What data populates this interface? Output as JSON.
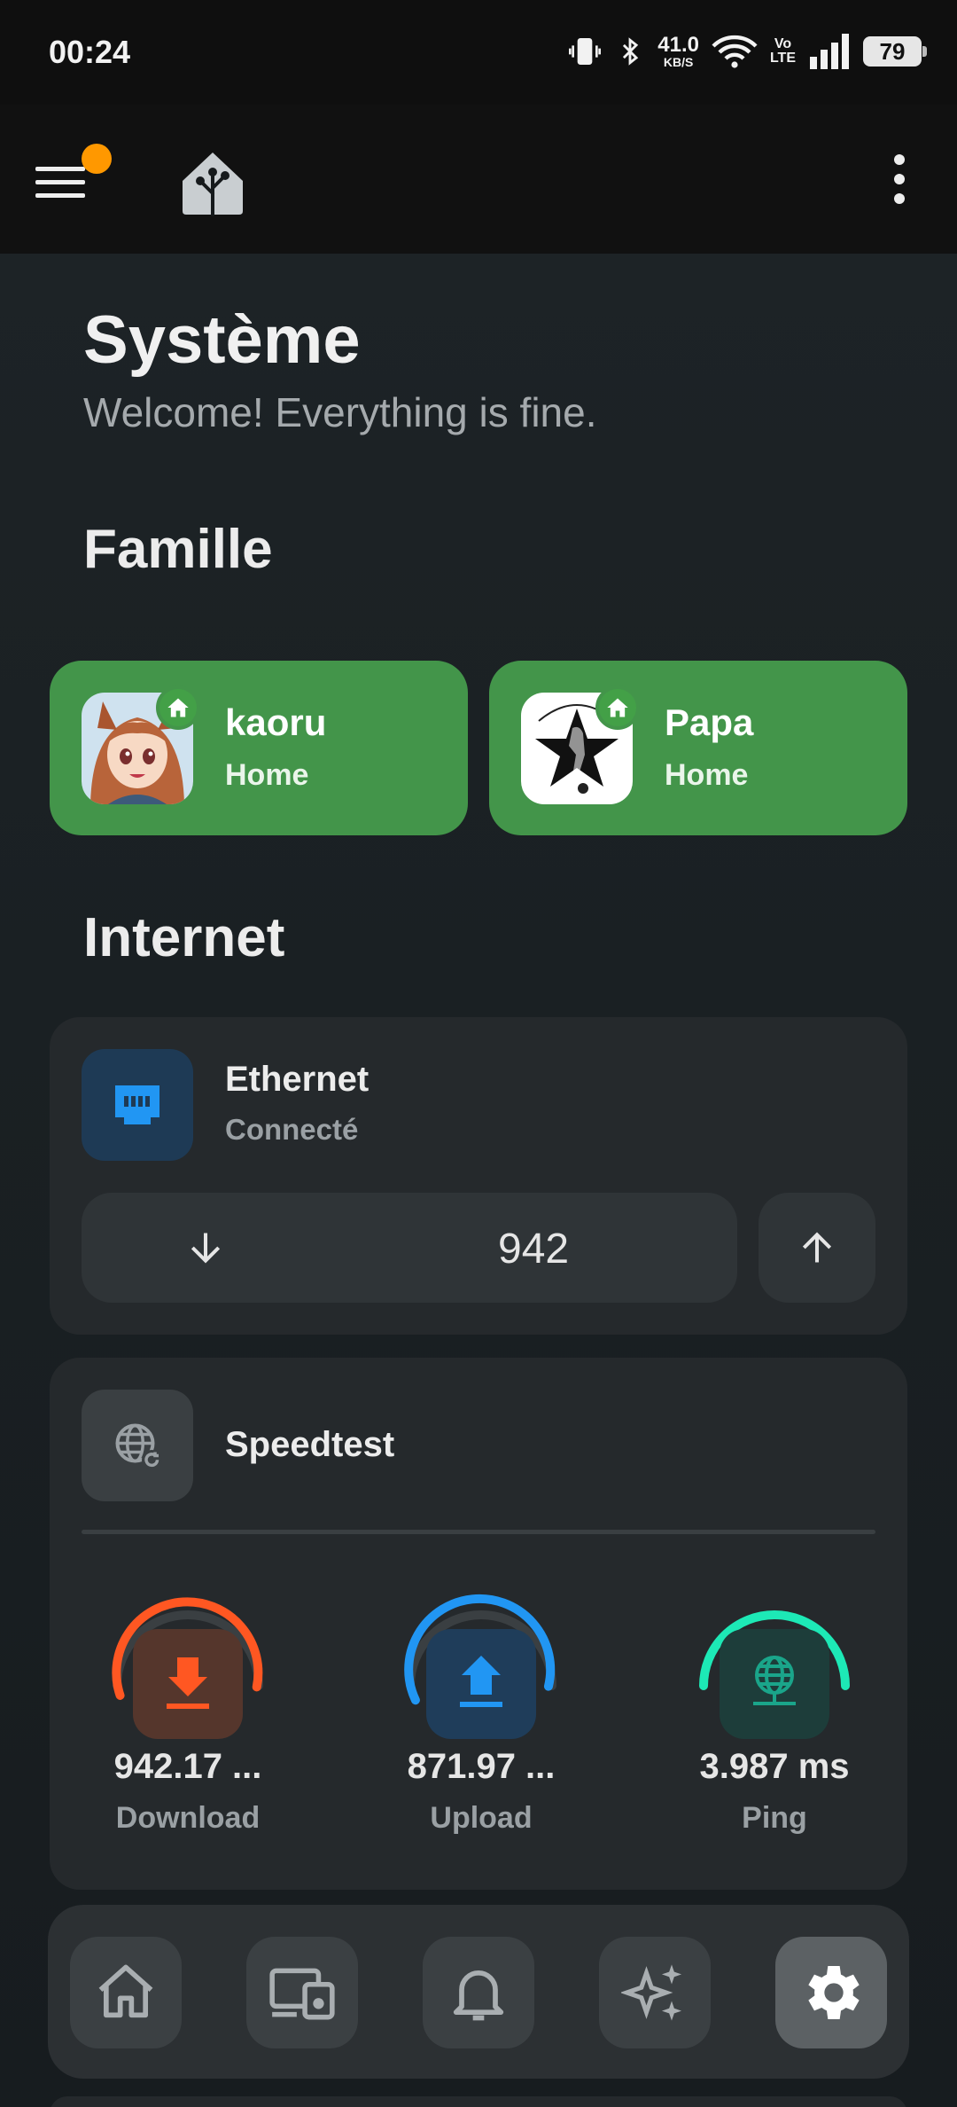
{
  "status_bar": {
    "time": "00:24",
    "net_speed_value": "41.0",
    "net_speed_unit": "KB/S",
    "volte_top": "Vo",
    "volte_bottom": "LTE",
    "battery": "79",
    "icons": [
      "vibrate-icon",
      "bluetooth-icon",
      "wifi-icon",
      "signal-icon",
      "battery-icon"
    ]
  },
  "app_bar": {
    "icons": [
      "menu-icon",
      "home-assistant-logo",
      "more-vert-icon"
    ],
    "notification_color": "#ff9800"
  },
  "page": {
    "title": "Système",
    "subtitle": "Welcome! Everything is fine."
  },
  "family": {
    "title": "Famille",
    "people": [
      {
        "name": "kaoru",
        "state": "Home"
      },
      {
        "name": "Papa",
        "state": "Home"
      }
    ],
    "card_color": "#43954a"
  },
  "internet": {
    "title": "Internet",
    "ethernet": {
      "title": "Ethernet",
      "state": "Connecté",
      "value": "942",
      "icon": "ethernet-icon",
      "accent": "#2196f3"
    },
    "speedtest": {
      "title": "Speedtest",
      "icon": "web-refresh-icon",
      "gauges": [
        {
          "value": "942.17 ...",
          "label": "Download",
          "color": "#ff5722",
          "icon": "download-icon",
          "fill": 0.82
        },
        {
          "value": "871.97 ...",
          "label": "Upload",
          "color": "#2196f3",
          "icon": "upload-icon",
          "fill": 0.78
        },
        {
          "value": "3.987 ms",
          "label": "Ping",
          "color": "#1de9b6",
          "icon": "web-icon",
          "fill": 1.0
        }
      ]
    }
  },
  "bottom_nav": {
    "items": [
      {
        "name": "home",
        "icon": "home-icon",
        "active": false
      },
      {
        "name": "devices",
        "icon": "devices-icon",
        "active": false
      },
      {
        "name": "notifications",
        "icon": "bell-icon",
        "active": false
      },
      {
        "name": "assist",
        "icon": "sparkles-icon",
        "active": false
      },
      {
        "name": "settings",
        "icon": "gear-icon",
        "active": true
      }
    ]
  }
}
